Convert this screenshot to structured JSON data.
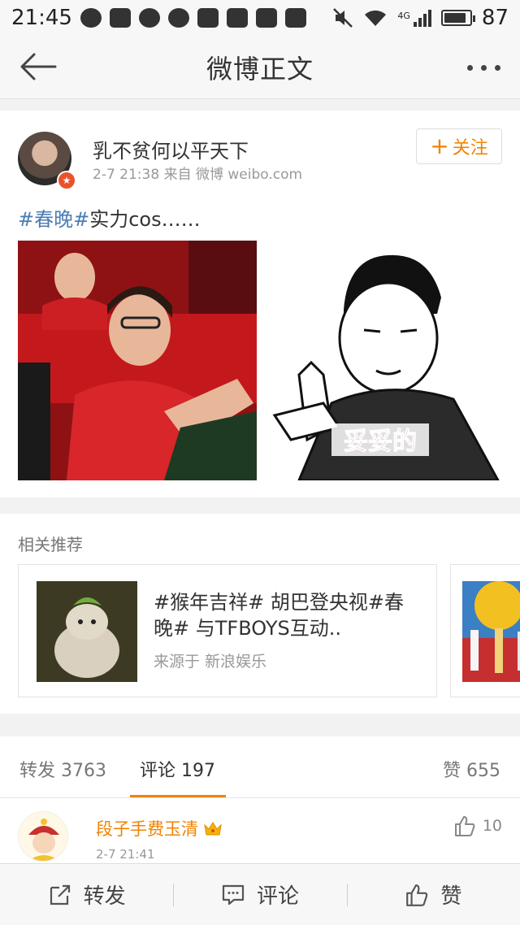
{
  "status_bar": {
    "time": "21:45",
    "network": "4G",
    "battery": "87",
    "battery_level": 0.87
  },
  "nav": {
    "title": "微博正文"
  },
  "post": {
    "username": "乳不贫何以平天下",
    "meta": "2-7 21:38   来自 微博 weibo.com",
    "follow_label": "关注",
    "hashtag": "#春晚#",
    "text": "实力cos……",
    "image_caption": "妥妥的"
  },
  "related": {
    "title": "相关推荐",
    "items": [
      {
        "text": "#猴年吉祥# 胡巴登央视#春晚# 与TFBOYS互动..",
        "source": "来源于 新浪娱乐"
      }
    ]
  },
  "stats": {
    "repost": "转发 3763",
    "comment": "评论 197",
    "like": "赞 655"
  },
  "comment": {
    "name": "段子手费玉清",
    "time": "2-7 21:41",
    "likes": "10"
  },
  "bottom_bar": {
    "repost": "转发",
    "comment": "评论",
    "like": "赞"
  },
  "colors": {
    "accent": "#f08300",
    "link": "#4a7db6"
  }
}
